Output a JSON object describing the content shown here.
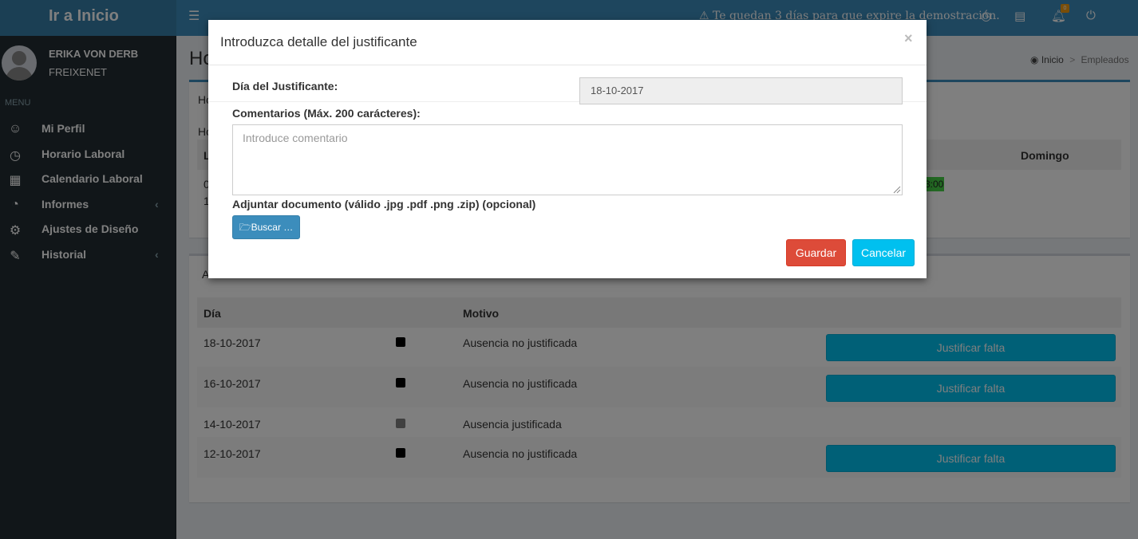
{
  "header": {
    "logo": "Ir a Inicio",
    "warning": "Te quedan 3 días para que expire la demostración.",
    "notification_count": "0"
  },
  "sidebar": {
    "user_name": "ERIKA VON DERB",
    "company": "FREIXENET",
    "menu_header": "MENU",
    "items": [
      {
        "label": "Mi Perfil",
        "icon": "smile-icon"
      },
      {
        "label": "Horario Laboral",
        "icon": "clock-icon"
      },
      {
        "label": "Calendario Laboral",
        "icon": "calendar-icon"
      },
      {
        "label": "Informes",
        "icon": "pie-chart-icon"
      },
      {
        "label": "Ajustes de Diseño",
        "icon": "gear-icon"
      },
      {
        "label": "Historial",
        "icon": "edit-icon"
      }
    ]
  },
  "content": {
    "title_fragment": "Ho",
    "breadcrumb": {
      "home": "Inicio",
      "current": "Empleados"
    },
    "box1": {
      "line1": "Ho",
      "line2": "Ho",
      "col_first": "L",
      "col_domingo": "Domingo",
      "cell_a": "0",
      "cell_b": "1",
      "highlight": "3:00"
    },
    "box2": {
      "tab_fragment": "A",
      "columns": {
        "dia": "Día",
        "motivo": "Motivo"
      },
      "rows": [
        {
          "date": "18-10-2017",
          "reason": "Ausencia no justificada",
          "status_color": "#000000",
          "action": "Justificar falta"
        },
        {
          "date": "16-10-2017",
          "reason": "Ausencia no justificada",
          "status_color": "#000000",
          "action": "Justificar falta"
        },
        {
          "date": "14-10-2017",
          "reason": "Ausencia justificada",
          "status_color": "#808080",
          "action": ""
        },
        {
          "date": "12-10-2017",
          "reason": "Ausencia no justificada",
          "status_color": "#000000",
          "action": "Justificar falta"
        }
      ]
    }
  },
  "modal": {
    "title": "Introduzca detalle del justificante",
    "close": "×",
    "date_label": "Día del Justificante:",
    "date_value": "18-10-2017",
    "comment_label": "Comentarios (Máx. 200 carácteres):",
    "comment_placeholder": "Introduce comentario",
    "attach_label": "Adjuntar documento (válido .jpg .pdf .png .zip) (opcional)",
    "browse": "Buscar …",
    "save": "Guardar",
    "cancel": "Cancelar"
  },
  "colors": {
    "primary": "#3c8dbc",
    "info": "#00c0ef",
    "danger": "#dd4b39",
    "sidebar": "#222d32"
  }
}
